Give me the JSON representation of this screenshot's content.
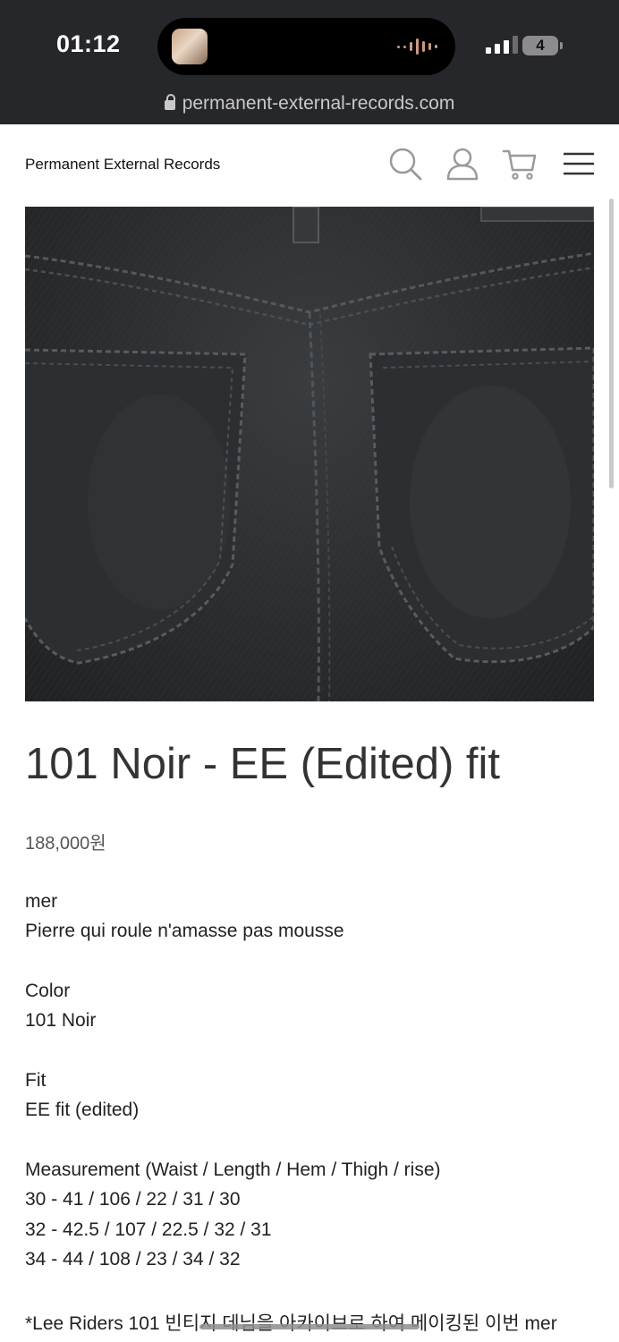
{
  "status_bar": {
    "time": "01:12",
    "battery": "4",
    "url": "permanent-external-records.com"
  },
  "header": {
    "site_title": "Permanent External Records",
    "icons": [
      "search-icon",
      "account-icon",
      "cart-icon",
      "menu-icon"
    ]
  },
  "product": {
    "title": "101 Noir - EE (Edited) fit",
    "price": "188,000원",
    "brand_label": "mer",
    "tagline": "Pierre qui roule n'amasse pas mousse",
    "color_label": "Color",
    "color_value": "101 Noir",
    "fit_label": "Fit",
    "fit_value": "EE fit (edited)",
    "measurement_label": "Measurement (Waist / Length / Hem / Thigh / rise)",
    "measurements": [
      "30 - 41 / 106 / 22 / 31 / 30",
      "32 - 42.5 / 107 / 22.5 / 32 / 31",
      "34 - 44 / 108 / 23 / 34 / 32"
    ],
    "note": "*Lee Riders 101 빈티지 데님을 아카이브로 하여 메이킹된 이번 mer"
  },
  "colors": {
    "status_bar_bg": "#26272b",
    "text": "#333333",
    "icon": "#9a9a9a"
  }
}
